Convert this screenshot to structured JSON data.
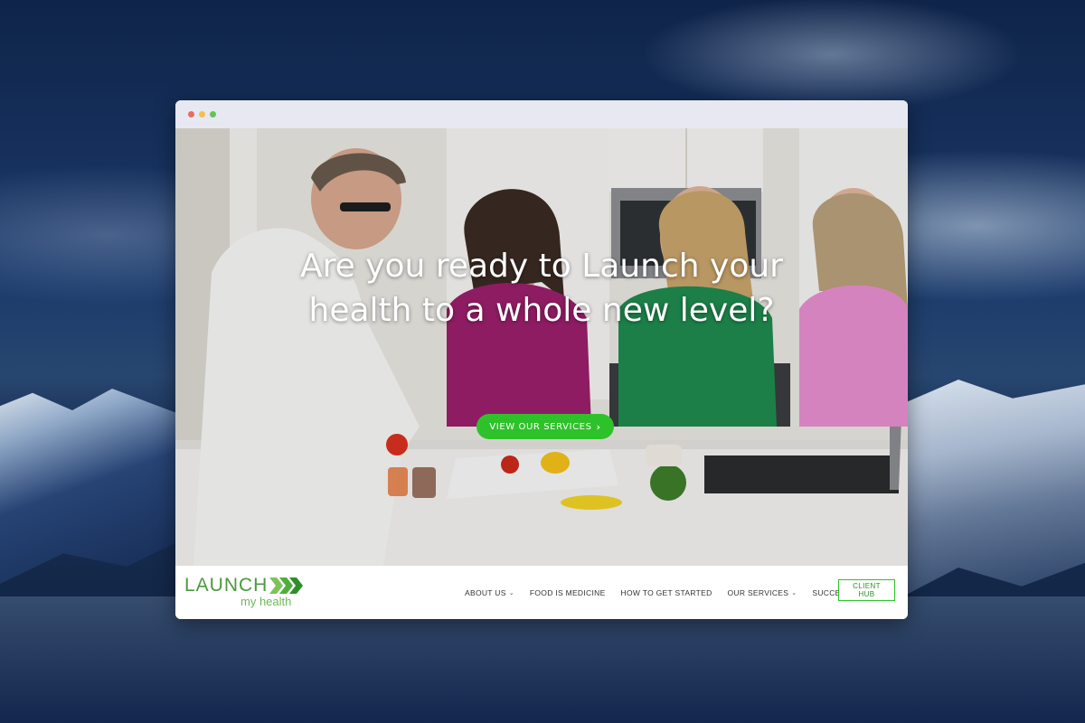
{
  "hero": {
    "heading": "Are you ready to Launch your health to a whole new level?",
    "cta_label": "VIEW OUR SERVICES"
  },
  "logo": {
    "wordmark": "LAUNCH",
    "subtitle": "my health",
    "icon": "triple-chevron-icon"
  },
  "nav": {
    "items": [
      {
        "label": "ABOUT US",
        "has_dropdown": true
      },
      {
        "label": "FOOD IS MEDICINE",
        "has_dropdown": false
      },
      {
        "label": "HOW TO GET STARTED",
        "has_dropdown": false
      },
      {
        "label": "OUR SERVICES",
        "has_dropdown": true
      },
      {
        "label": "SUCCESS STORIES",
        "has_dropdown": false
      }
    ],
    "client_hub_label": "CLIENT HUB"
  },
  "colors": {
    "brand_green": "#2ec22a",
    "logo_green": "#4a9a3c"
  }
}
